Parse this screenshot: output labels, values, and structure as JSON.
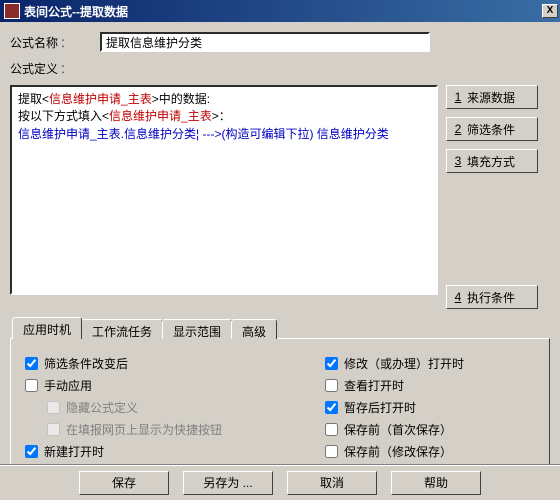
{
  "window": {
    "title": "表间公式--提取数据",
    "close": "X"
  },
  "labels": {
    "formula_name": "公式名称",
    "formula_def": "公式定义",
    "colon": "："
  },
  "fields": {
    "formula_name_value": "提取信息维护分类"
  },
  "formula_parts": {
    "t1": "提取<",
    "t2": "信息维护申请_主表",
    "t3": ">中的数据:",
    "t4": "按以下方式填入<",
    "t5": "信息维护申请_主表",
    "t6": ">：",
    "t7": "信息维护申请_主表.信息维护分类¦  --->(构造可编辑下拉)   信息维护分类"
  },
  "side_buttons": {
    "b1_num": "1",
    "b1_label": "来源数据",
    "b2_num": "2",
    "b2_label": "筛选条件",
    "b3_num": "3",
    "b3_label": "填充方式",
    "b4_num": "4",
    "b4_label": "执行条件"
  },
  "tabs": {
    "t0": "应用时机",
    "t1": "工作流任务",
    "t2": "显示范围",
    "t3": "高级"
  },
  "opts_left": {
    "o1": "筛选条件改变后",
    "o2": "手动应用",
    "o3": "隐藏公式定义",
    "o4": "在填报网页上显示为快捷按钮",
    "o5": "新建打开时"
  },
  "opts_right": {
    "r1": "修改（或办理）打开时",
    "r2": "查看打开时",
    "r3": "暂存后打开时",
    "r4": "保存前（首次保存）",
    "r5": "保存前（修改保存）"
  },
  "bottom": {
    "save": "保存",
    "saveas": "另存为 ...",
    "cancel": "取消",
    "help": "帮助"
  }
}
